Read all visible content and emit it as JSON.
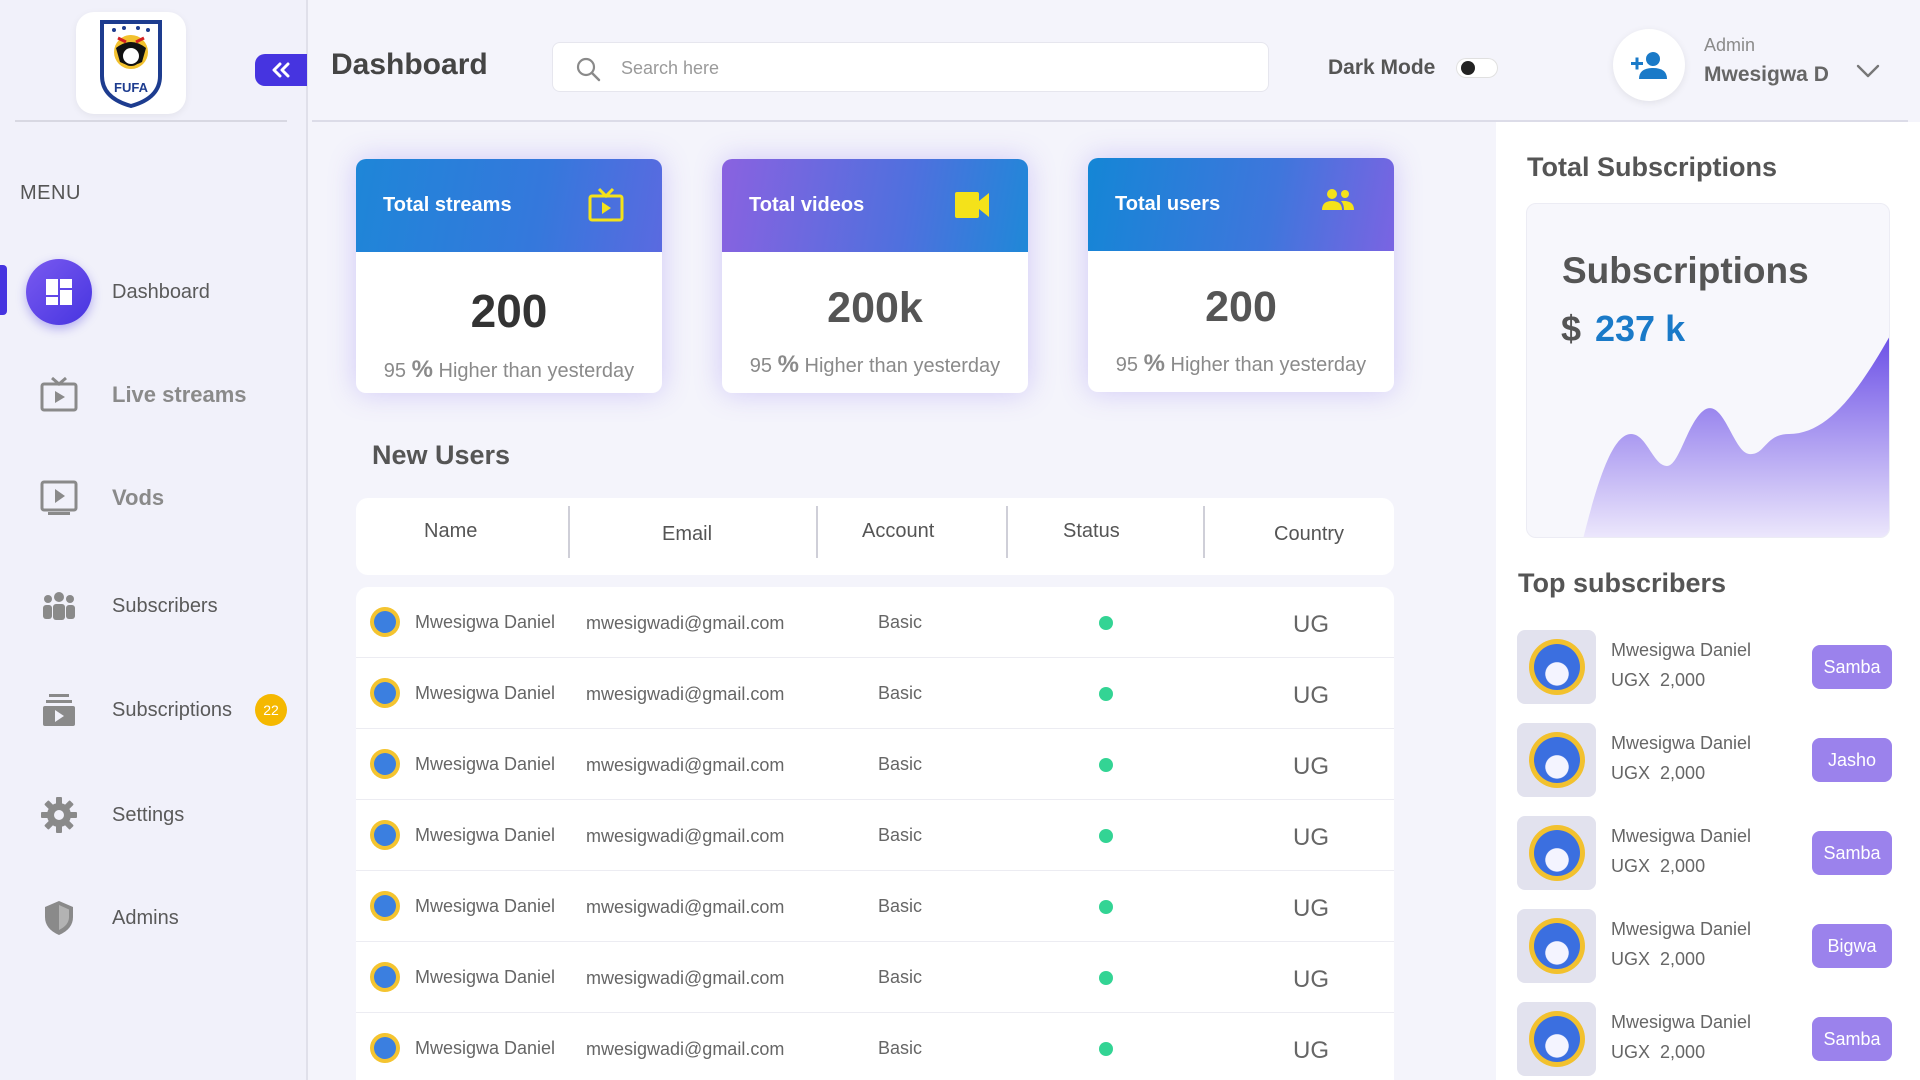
{
  "brand": {
    "logo_text": "FUFA"
  },
  "sidebar": {
    "menu_label": "MENU",
    "items": [
      {
        "label": "Dashboard",
        "icon": "dashboard-icon"
      },
      {
        "label": "Live streams",
        "icon": "live-tv-icon"
      },
      {
        "label": "Vods",
        "icon": "video-play-icon"
      },
      {
        "label": "Subscribers",
        "icon": "group-icon"
      },
      {
        "label": "Subscriptions",
        "icon": "subscriptions-icon",
        "badge": "22"
      },
      {
        "label": "Settings",
        "icon": "gear-icon"
      },
      {
        "label": "Admins",
        "icon": "shield-icon"
      }
    ]
  },
  "header": {
    "title": "Dashboard",
    "search_placeholder": "Search here",
    "dark_mode_label": "Dark Mode",
    "dark_mode_on": false,
    "user_role": "Admin",
    "user_name": "Mwesigwa D"
  },
  "stats": [
    {
      "title": "Total streams",
      "value": "200",
      "pct": "95",
      "pct_symbol": "%",
      "note": "Higher than yesterday",
      "icon": "tv-icon"
    },
    {
      "title": "Total videos",
      "value": "200k",
      "pct": "95",
      "pct_symbol": "%",
      "note": "Higher than yesterday",
      "icon": "video-camera-icon"
    },
    {
      "title": "Total users",
      "value": "200",
      "pct": "95",
      "pct_symbol": "%",
      "note": "Higher than yesterday",
      "icon": "users-icon"
    }
  ],
  "new_users": {
    "title": "New Users",
    "columns": [
      "Name",
      "Email",
      "Account",
      "Status",
      "Country"
    ],
    "rows": [
      {
        "name": "Mwesigwa Daniel",
        "email": "mwesigwadi@gmail.com",
        "account": "Basic",
        "status": "active",
        "country": "UG"
      },
      {
        "name": "Mwesigwa Daniel",
        "email": "mwesigwadi@gmail.com",
        "account": "Basic",
        "status": "active",
        "country": "UG"
      },
      {
        "name": "Mwesigwa Daniel",
        "email": "mwesigwadi@gmail.com",
        "account": "Basic",
        "status": "active",
        "country": "UG"
      },
      {
        "name": "Mwesigwa Daniel",
        "email": "mwesigwadi@gmail.com",
        "account": "Basic",
        "status": "active",
        "country": "UG"
      },
      {
        "name": "Mwesigwa Daniel",
        "email": "mwesigwadi@gmail.com",
        "account": "Basic",
        "status": "active",
        "country": "UG"
      },
      {
        "name": "Mwesigwa Daniel",
        "email": "mwesigwadi@gmail.com",
        "account": "Basic",
        "status": "active",
        "country": "UG"
      },
      {
        "name": "Mwesigwa Daniel",
        "email": "mwesigwadi@gmail.com",
        "account": "Basic",
        "status": "active",
        "country": "UG"
      }
    ]
  },
  "subscriptions": {
    "section_title": "Total Subscriptions",
    "card_title": "Subscriptions",
    "currency": "$",
    "amount": "237 k"
  },
  "top_subscribers": {
    "title": "Top subscribers",
    "items": [
      {
        "name": "Mwesigwa Daniel",
        "currency": "UGX",
        "amount": "2,000",
        "plan": "Samba"
      },
      {
        "name": "Mwesigwa Daniel",
        "currency": "UGX",
        "amount": "2,000",
        "plan": "Jasho"
      },
      {
        "name": "Mwesigwa Daniel",
        "currency": "UGX",
        "amount": "2,000",
        "plan": "Samba"
      },
      {
        "name": "Mwesigwa Daniel",
        "currency": "UGX",
        "amount": "2,000",
        "plan": "Bigwa"
      },
      {
        "name": "Mwesigwa Daniel",
        "currency": "UGX",
        "amount": "2,000",
        "plan": "Samba"
      }
    ]
  },
  "colors": {
    "accent": "#4634e0",
    "badge": "#f5b800",
    "status_active": "#33d494",
    "plan_button": "#9b82ec",
    "amount_blue": "#1a7ac8"
  }
}
